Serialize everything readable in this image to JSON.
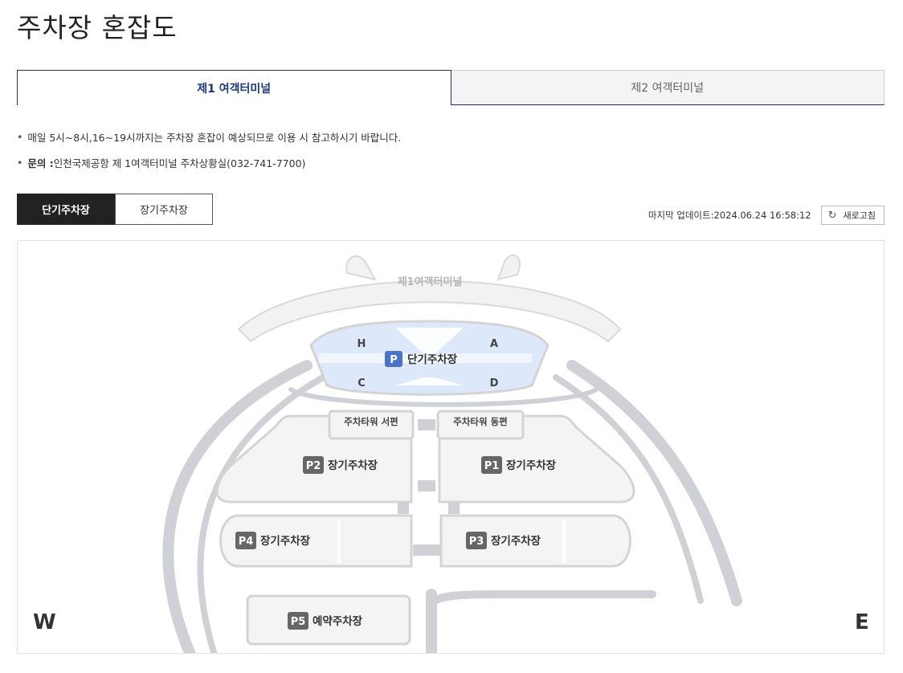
{
  "page": {
    "title": "주차장 혼잡도"
  },
  "tabs": [
    {
      "label": "제1 여객터미널",
      "active": true
    },
    {
      "label": "제2 여객터미널",
      "active": false
    }
  ],
  "notes": {
    "line1": "매일 5시~8시,16~19시까지는 주차장 혼잡이 예상되므로 이용 시 참고하시기 바랍니다.",
    "line2_label": "문의 :",
    "line2_text": "인천국제공항 제 1여객터미널 주차상황실(032-741-7700)"
  },
  "parking_tabs": [
    {
      "label": "단기주차장",
      "active": true
    },
    {
      "label": "장기주차장",
      "active": false
    }
  ],
  "update": {
    "text": "마지막 업데이트:2024.06.24 16:58:12",
    "refresh_label": "새로고침",
    "refresh_icon": "refresh-icon"
  },
  "map": {
    "terminal_label": "제1여객터미널",
    "short_term": {
      "badge": "P",
      "label": "단기주차장",
      "zones": [
        "H",
        "A",
        "C",
        "D"
      ]
    },
    "tower_west": "주차타워 서편",
    "tower_east": "주차타워 동편",
    "lots": [
      {
        "badge": "P2",
        "label": "장기주차장"
      },
      {
        "badge": "P1",
        "label": "장기주차장"
      },
      {
        "badge": "P4",
        "label": "장기주차장"
      },
      {
        "badge": "P3",
        "label": "장기주차장"
      },
      {
        "badge": "P5",
        "label": "예약주차장"
      }
    ],
    "west": "W",
    "east": "E",
    "colors": {
      "short_term_fill": "#dde8fb",
      "badge_blue": "#4a72c6",
      "badge_gray": "#666666",
      "road": "#cfd1d6"
    }
  }
}
